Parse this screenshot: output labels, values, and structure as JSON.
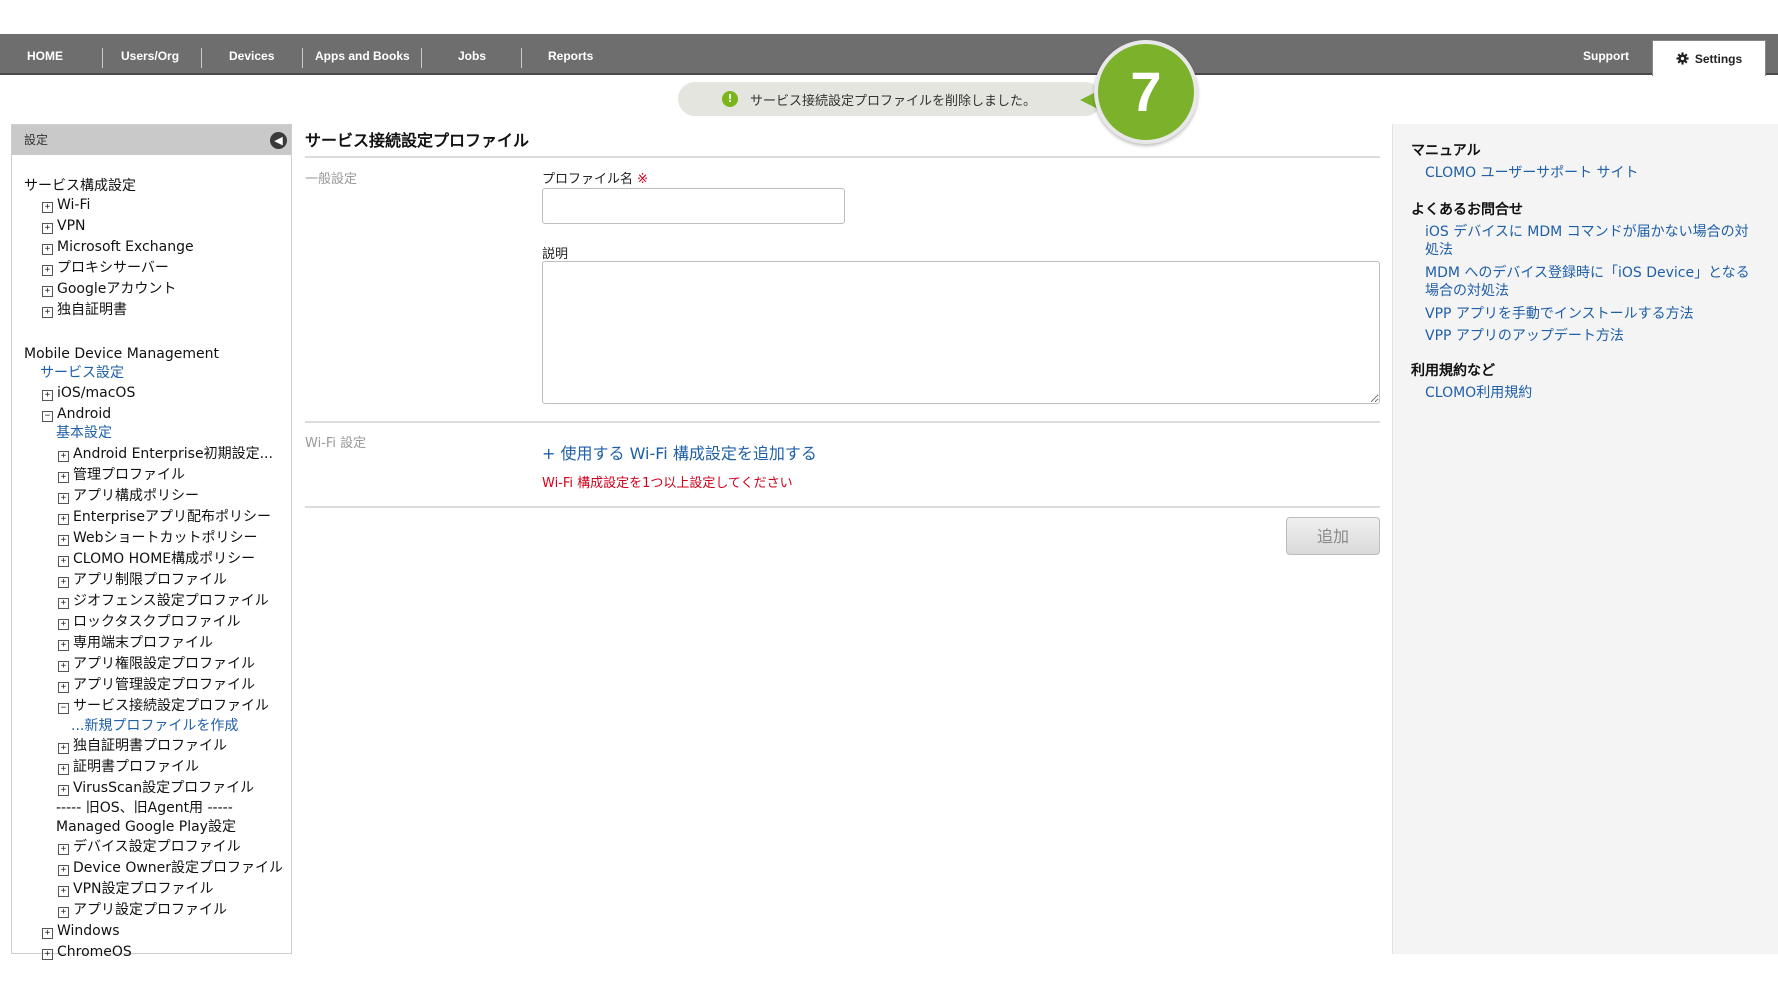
{
  "nav": {
    "items": [
      "HOME",
      "Users/Org",
      "Devices",
      "Apps and Books",
      "Jobs",
      "Reports"
    ],
    "support": "Support",
    "settings": "Settings"
  },
  "notice": {
    "icon": "exclamation-icon",
    "message": "サービス接続設定プロファイルを削除しました。",
    "step": "7",
    "accent": "#7bb12b"
  },
  "sidebar": {
    "header": "設定",
    "tree": [
      {
        "label": "サービス構成設定",
        "toggle": ""
      },
      {
        "label": "Wi-Fi",
        "toggle": "+"
      },
      {
        "label": "VPN",
        "toggle": "+"
      },
      {
        "label": "Microsoft Exchange",
        "toggle": "+"
      },
      {
        "label": "プロキシサーバー",
        "toggle": "+"
      },
      {
        "label": "Googleアカウント",
        "toggle": "+"
      },
      {
        "label": "独自証明書",
        "toggle": "+"
      },
      {
        "label": "Mobile Device Management",
        "toggle": ""
      },
      {
        "label": "サービス設定",
        "toggle": "",
        "link": true
      },
      {
        "label": "iOS/macOS",
        "toggle": "+"
      },
      {
        "label": "Android",
        "toggle": "-"
      },
      {
        "label": "基本設定",
        "toggle": "",
        "link": true
      },
      {
        "label": "Android Enterprise初期設定...",
        "toggle": "+"
      },
      {
        "label": "管理プロファイル",
        "toggle": "+"
      },
      {
        "label": "アプリ構成ポリシー",
        "toggle": "+"
      },
      {
        "label": "Enterpriseアプリ配布ポリシー",
        "toggle": "+"
      },
      {
        "label": "Webショートカットポリシー",
        "toggle": "+"
      },
      {
        "label": "CLOMO HOME構成ポリシー",
        "toggle": "+"
      },
      {
        "label": "アプリ制限プロファイル",
        "toggle": "+"
      },
      {
        "label": "ジオフェンス設定プロファイル",
        "toggle": "+"
      },
      {
        "label": "ロックタスクプロファイル",
        "toggle": "+"
      },
      {
        "label": "専用端末プロファイル",
        "toggle": "+"
      },
      {
        "label": "アプリ権限設定プロファイル",
        "toggle": "+"
      },
      {
        "label": "アプリ管理設定プロファイル",
        "toggle": "+"
      },
      {
        "label": "サービス接続設定プロファイル",
        "toggle": "-"
      },
      {
        "label": "...新規プロファイルを作成",
        "toggle": "",
        "link": true
      },
      {
        "label": "独自証明書プロファイル",
        "toggle": "+"
      },
      {
        "label": "証明書プロファイル",
        "toggle": "+"
      },
      {
        "label": "VirusScan設定プロファイル",
        "toggle": "+"
      },
      {
        "label": "----- 旧OS、旧Agent用 -----",
        "toggle": ""
      },
      {
        "label": "Managed Google Play設定",
        "toggle": ""
      },
      {
        "label": "デバイス設定プロファイル",
        "toggle": "+"
      },
      {
        "label": "Device Owner設定プロファイル",
        "toggle": "+"
      },
      {
        "label": "VPN設定プロファイル",
        "toggle": "+"
      },
      {
        "label": "アプリ設定プロファイル",
        "toggle": "+"
      },
      {
        "label": "Windows",
        "toggle": "+"
      },
      {
        "label": "ChromeOS",
        "toggle": "+"
      }
    ]
  },
  "main": {
    "title": "サービス接続設定プロファイル",
    "general_section": "一般設定",
    "profile_name_label": "プロファイル名",
    "required_mark": "※",
    "profile_name_value": "",
    "description_label": "説明",
    "description_value": "",
    "wifi_section": "Wi-Fi 設定",
    "add_wifi_link": "+ 使用する Wi-Fi 構成設定を追加する",
    "wifi_error": "Wi-Fi 構成設定を1つ以上設定してください",
    "add_button": "追加"
  },
  "right": {
    "manual_head": "マニュアル",
    "manual_link": "CLOMO ユーザーサポート サイト",
    "faq_head": "よくあるお問合せ",
    "faq_links": [
      "iOS デバイスに MDM コマンドが届かない場合の対処法",
      "MDM へのデバイス登録時に「iOS Device」となる場合の対処法",
      "VPP アプリを手動でインストールする方法",
      "VPP アプリのアップデート方法"
    ],
    "terms_head": "利用規約など",
    "terms_link": "CLOMO利用規約"
  }
}
